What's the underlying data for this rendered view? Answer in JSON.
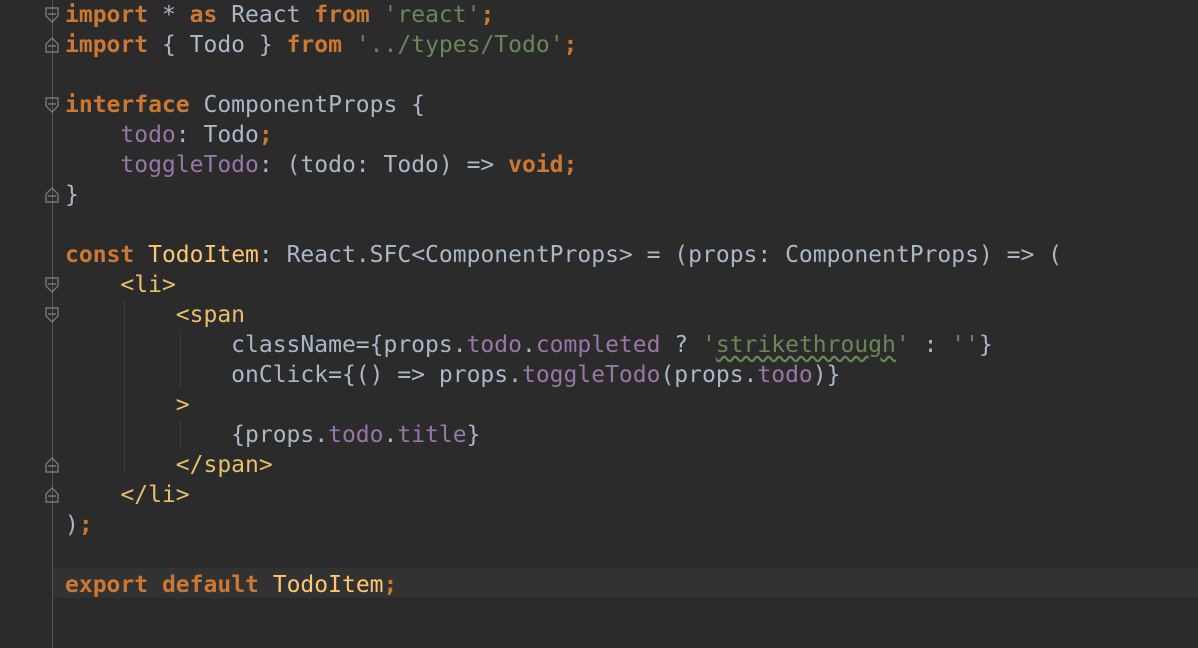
{
  "editor": {
    "language": "TypeScript (TSX)",
    "colors": {
      "background": "#2b2b2b",
      "keyword": "#cc7832",
      "string": "#6a8759",
      "field": "#9876aa",
      "tag": "#e8bf6a",
      "function_name": "#ffc66d",
      "text": "#a9b7c6"
    },
    "lines": [
      [
        {
          "t": "import",
          "c": "kw"
        },
        {
          "t": " * ",
          "c": ""
        },
        {
          "t": "as",
          "c": "kw"
        },
        {
          "t": " React ",
          "c": ""
        },
        {
          "t": "from",
          "c": "kw"
        },
        {
          "t": " ",
          "c": ""
        },
        {
          "t": "'react'",
          "c": "str"
        },
        {
          "t": ";",
          "c": "kw"
        }
      ],
      [
        {
          "t": "import",
          "c": "kw"
        },
        {
          "t": " { Todo } ",
          "c": ""
        },
        {
          "t": "from",
          "c": "kw"
        },
        {
          "t": " ",
          "c": ""
        },
        {
          "t": "'../types/Todo'",
          "c": "str"
        },
        {
          "t": ";",
          "c": "kw"
        }
      ],
      [],
      [
        {
          "t": "interface",
          "c": "kw"
        },
        {
          "t": " ComponentProps {",
          "c": ""
        }
      ],
      [
        {
          "t": "    ",
          "c": ""
        },
        {
          "t": "todo",
          "c": "fld"
        },
        {
          "t": ": Todo",
          "c": ""
        },
        {
          "t": ";",
          "c": "kw"
        }
      ],
      [
        {
          "t": "    ",
          "c": ""
        },
        {
          "t": "toggleTodo",
          "c": "fld"
        },
        {
          "t": ": (todo: Todo) => ",
          "c": ""
        },
        {
          "t": "void",
          "c": "kw"
        },
        {
          "t": ";",
          "c": "kw"
        }
      ],
      [
        {
          "t": "}",
          "c": ""
        }
      ],
      [],
      [
        {
          "t": "const",
          "c": "kw"
        },
        {
          "t": " ",
          "c": ""
        },
        {
          "t": "TodoItem",
          "c": "tn"
        },
        {
          "t": ": React.SFC<ComponentProps> = (props: ComponentProps) => (",
          "c": ""
        }
      ],
      [
        {
          "t": "    ",
          "c": ""
        },
        {
          "t": "<li>",
          "c": "tag"
        }
      ],
      [
        {
          "t": "        ",
          "c": ""
        },
        {
          "t": "<span",
          "c": "tag"
        }
      ],
      [
        {
          "t": "            className={props.",
          "c": ""
        },
        {
          "t": "todo",
          "c": "fld"
        },
        {
          "t": ".",
          "c": ""
        },
        {
          "t": "completed",
          "c": "fld"
        },
        {
          "t": " ? ",
          "c": ""
        },
        {
          "t": "'",
          "c": "str"
        },
        {
          "t": "strikethrough",
          "c": "str squiggle"
        },
        {
          "t": "'",
          "c": "str"
        },
        {
          "t": " : ",
          "c": ""
        },
        {
          "t": "''",
          "c": "str"
        },
        {
          "t": "}",
          "c": ""
        }
      ],
      [
        {
          "t": "            onClick={() => props.",
          "c": ""
        },
        {
          "t": "toggleTodo",
          "c": "fld"
        },
        {
          "t": "(props.",
          "c": ""
        },
        {
          "t": "todo",
          "c": "fld"
        },
        {
          "t": ")}",
          "c": ""
        }
      ],
      [
        {
          "t": "        ",
          "c": ""
        },
        {
          "t": ">",
          "c": "tag"
        }
      ],
      [
        {
          "t": "            {props.",
          "c": ""
        },
        {
          "t": "todo",
          "c": "fld"
        },
        {
          "t": ".",
          "c": ""
        },
        {
          "t": "title",
          "c": "fld"
        },
        {
          "t": "}",
          "c": ""
        }
      ],
      [
        {
          "t": "        ",
          "c": ""
        },
        {
          "t": "</span>",
          "c": "tag"
        }
      ],
      [
        {
          "t": "    ",
          "c": ""
        },
        {
          "t": "</li>",
          "c": "tag"
        }
      ],
      [
        {
          "t": ")",
          "c": ""
        },
        {
          "t": ";",
          "c": "kw"
        }
      ],
      [],
      [
        {
          "t": "export",
          "c": "kw"
        },
        {
          "t": " ",
          "c": ""
        },
        {
          "t": "default",
          "c": "kw"
        },
        {
          "t": " TodoItem",
          "c": "tn"
        },
        {
          "t": ";",
          "c": "kw"
        }
      ]
    ],
    "folds": [
      {
        "line": 0,
        "dir": "down"
      },
      {
        "line": 1,
        "dir": "up"
      },
      {
        "line": 3,
        "dir": "down"
      },
      {
        "line": 6,
        "dir": "up"
      },
      {
        "line": 9,
        "dir": "down"
      },
      {
        "line": 10,
        "dir": "down"
      },
      {
        "line": 15,
        "dir": "up"
      },
      {
        "line": 16,
        "dir": "up"
      }
    ],
    "current_line": 19
  }
}
